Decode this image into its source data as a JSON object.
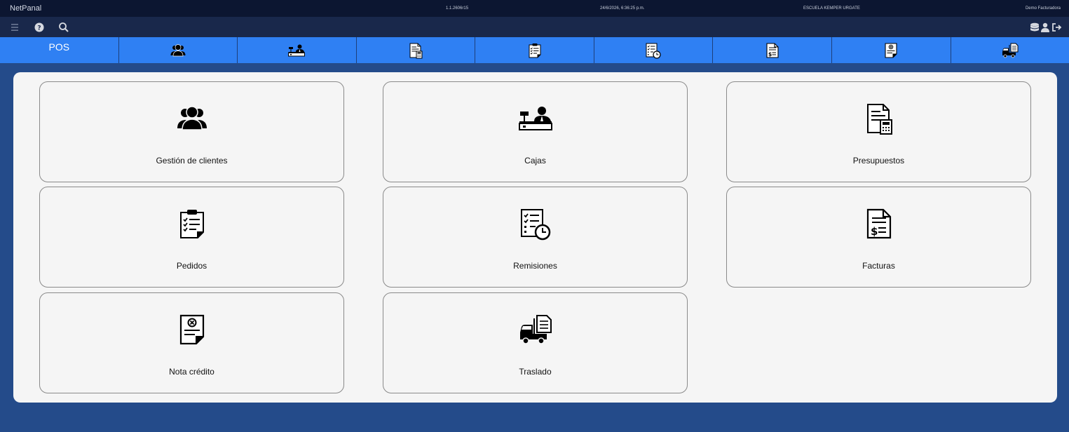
{
  "titlebar": {
    "app_name": "NetPanal",
    "version": "1.1.2606r15",
    "datetime": "24/6/2026, 6:36:25 p.m.",
    "company": "ESCUELA KEMPER URGATE",
    "user": "Demo Facturadora"
  },
  "toolbar": {
    "left_icons": [
      "menu-icon",
      "help-icon",
      "search-icon"
    ],
    "right_icons": [
      "database-icon",
      "user-icon",
      "logout-icon"
    ]
  },
  "modules": {
    "pos_label": "POS",
    "tabs": [
      "clients-icon",
      "cashier-icon",
      "budget-icon",
      "orders-icon",
      "remissions-icon",
      "invoice-icon",
      "credit-note-icon",
      "transfer-icon"
    ]
  },
  "cards": [
    {
      "label": "Gestión de clientes",
      "icon": "clients-icon"
    },
    {
      "label": "Cajas",
      "icon": "cashier-icon"
    },
    {
      "label": "Presupuestos",
      "icon": "budget-icon"
    },
    {
      "label": "Pedidos",
      "icon": "orders-icon"
    },
    {
      "label": "Remisiones",
      "icon": "remissions-icon"
    },
    {
      "label": "Facturas",
      "icon": "invoice-icon"
    },
    {
      "label": "Nota crédito",
      "icon": "credit-note-icon"
    },
    {
      "label": "Traslado",
      "icon": "transfer-icon"
    }
  ],
  "colors": {
    "titlebar": "#0c1631",
    "toolbar": "#19284b",
    "module_bar": "#2f80f3",
    "background": "#244b8a",
    "panel": "#f5f5f5"
  }
}
